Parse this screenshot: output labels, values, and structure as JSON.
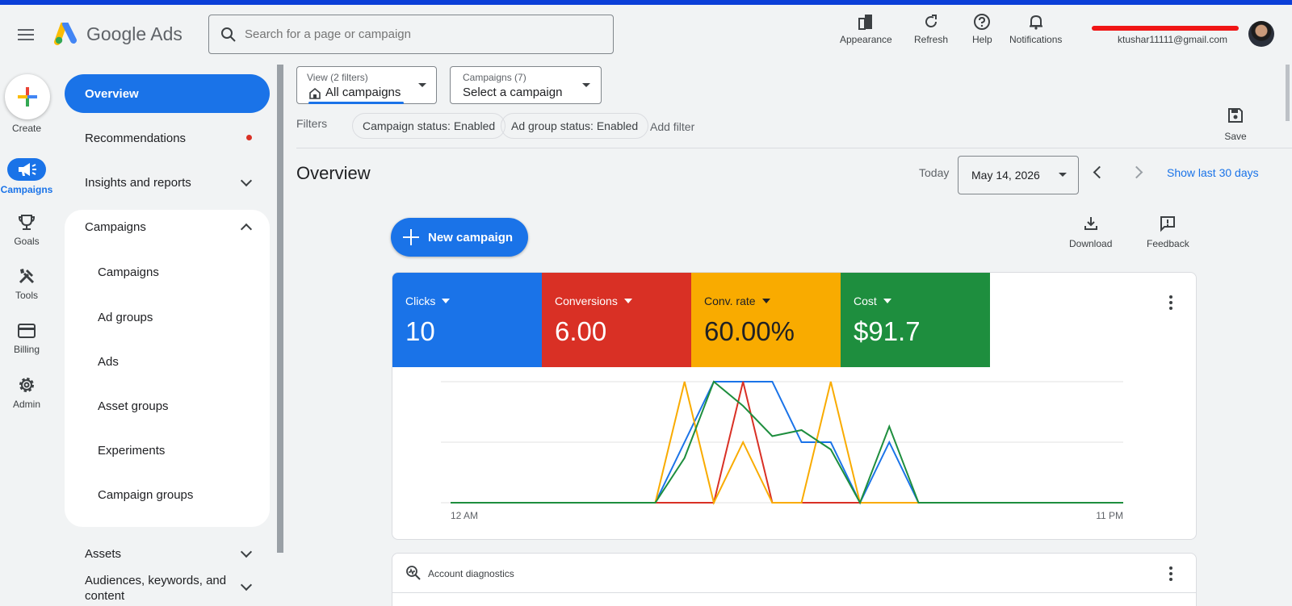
{
  "header": {
    "app_name": "Google Ads",
    "search_placeholder": "Search for a page or campaign",
    "actions": [
      {
        "label": "Appearance",
        "icon": "appearance-icon"
      },
      {
        "label": "Refresh",
        "icon": "refresh-icon"
      },
      {
        "label": "Help",
        "icon": "help-icon"
      },
      {
        "label": "Notifications",
        "icon": "bell-icon"
      }
    ],
    "user_email": "ktushar11111@gmail.com"
  },
  "rail": {
    "create_label": "Create",
    "items": [
      {
        "label": "Campaigns",
        "icon": "megaphone-icon",
        "active": true
      },
      {
        "label": "Goals",
        "icon": "trophy-icon"
      },
      {
        "label": "Tools",
        "icon": "tools-icon"
      },
      {
        "label": "Billing",
        "icon": "credit-card-icon"
      },
      {
        "label": "Admin",
        "icon": "gear-icon"
      }
    ]
  },
  "sidenav": {
    "overview": "Overview",
    "recommendations": "Recommendations",
    "insights": "Insights and reports",
    "campaigns_section": "Campaigns",
    "campaigns_sub": [
      "Campaigns",
      "Ad groups",
      "Ads",
      "Asset groups",
      "Experiments",
      "Campaign groups"
    ],
    "assets": "Assets",
    "audiences": "Audiences, keywords, and content"
  },
  "toolbar": {
    "view_small": "View (2 filters)",
    "view_value": "All campaigns",
    "campaigns_small": "Campaigns (7)",
    "campaigns_value": "Select a campaign",
    "filters_label": "Filters",
    "chips": [
      "Campaign status: Enabled",
      "Ad group status: Enabled"
    ],
    "add_filter": "Add filter",
    "save_label": "Save"
  },
  "overview": {
    "title": "Overview",
    "today_label": "Today",
    "date": "May 14, 2026",
    "show_last": "Show last 30 days",
    "new_campaign": "New campaign",
    "download": "Download",
    "feedback": "Feedback"
  },
  "metrics": [
    {
      "label": "Clicks",
      "value": "10",
      "color": "#1a73e8"
    },
    {
      "label": "Conversions",
      "value": "6.00",
      "color": "#d93025"
    },
    {
      "label": "Conv. rate",
      "value": "60.00%",
      "color": "#f9ab00"
    },
    {
      "label": "Cost",
      "value": "$91.7",
      "color": "#1e8e3e"
    }
  ],
  "chart_data": {
    "type": "line",
    "x_tick_labels": [
      "12 AM",
      "11 PM"
    ],
    "x": [
      0,
      1,
      2,
      3,
      4,
      5,
      6,
      7,
      8,
      9,
      10,
      11,
      12,
      13,
      14,
      15,
      16,
      17,
      18,
      19,
      20,
      21,
      22,
      23
    ],
    "ylim": [
      0,
      1
    ],
    "grid": true,
    "series": [
      {
        "color": "#1a73e8",
        "values": [
          0,
          0,
          0,
          0,
          0,
          0,
          0,
          0,
          0.5,
          1,
          1,
          1,
          0.5,
          0.5,
          0,
          0.5,
          0,
          0,
          0,
          0,
          0,
          0,
          0,
          0
        ]
      },
      {
        "color": "#d93025",
        "values": [
          0,
          0,
          0,
          0,
          0,
          0,
          0,
          0,
          0,
          0,
          1,
          0,
          0,
          0,
          0,
          0,
          0,
          0,
          0,
          0,
          0,
          0,
          0,
          0
        ]
      },
      {
        "color": "#f9ab00",
        "values": [
          0,
          0,
          0,
          0,
          0,
          0,
          0,
          0,
          1,
          0,
          0.5,
          0,
          0,
          1,
          0,
          0,
          0,
          0,
          0,
          0,
          0,
          0,
          0,
          0
        ]
      },
      {
        "color": "#1e8e3e",
        "values": [
          0,
          0,
          0,
          0,
          0,
          0,
          0,
          0,
          0.37,
          1,
          0.8,
          0.55,
          0.6,
          0.44,
          0,
          0.63,
          0,
          0,
          0,
          0,
          0,
          0,
          0,
          0
        ]
      }
    ]
  },
  "diagnostics": {
    "label": "Account diagnostics"
  }
}
